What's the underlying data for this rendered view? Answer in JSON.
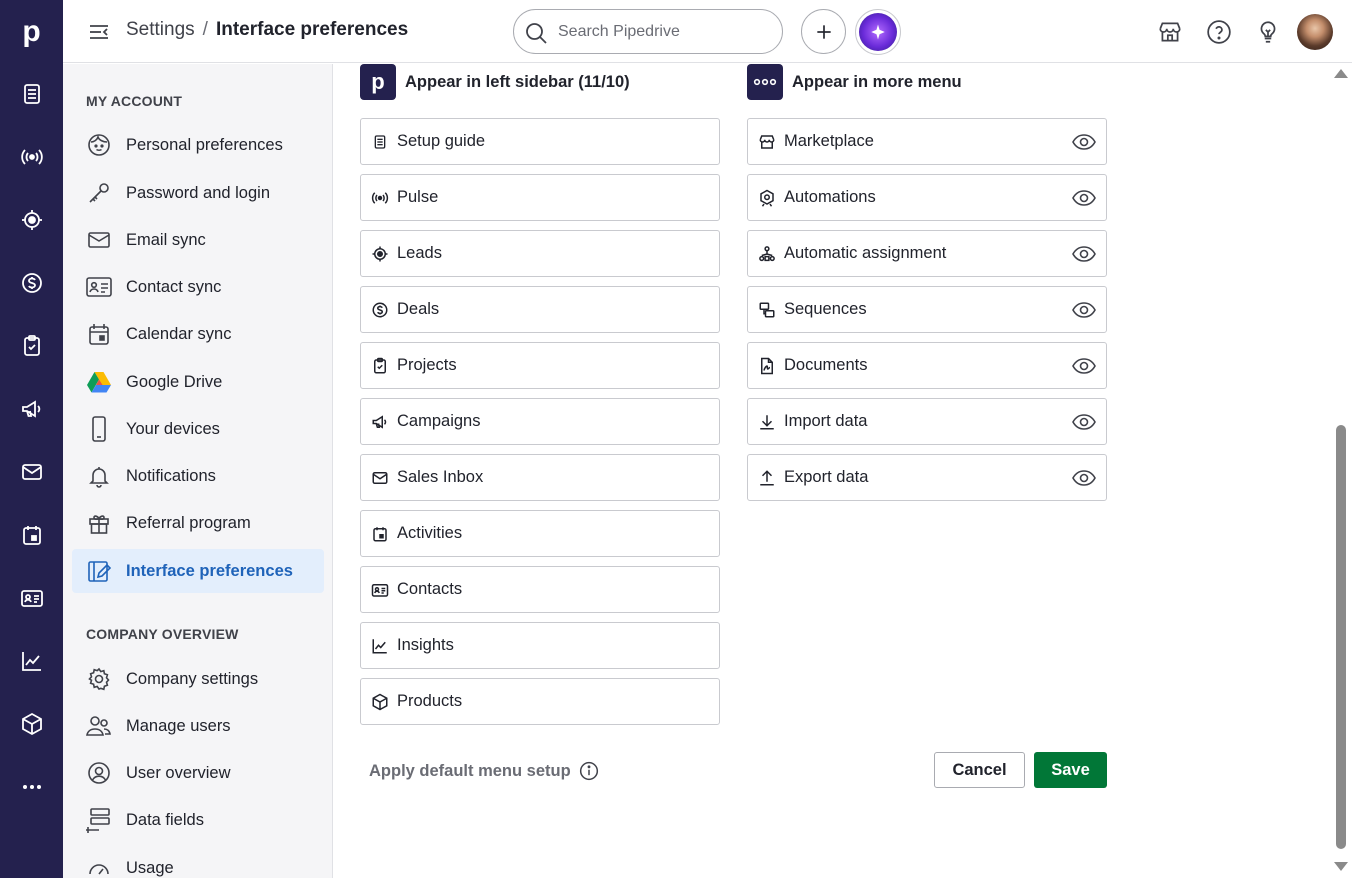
{
  "app": {
    "logo_letter": "p"
  },
  "rail": {
    "items": [
      {
        "icon": "setup-guide-icon"
      },
      {
        "icon": "pulse-icon"
      },
      {
        "icon": "leads-icon"
      },
      {
        "icon": "deals-icon"
      },
      {
        "icon": "projects-icon"
      },
      {
        "icon": "campaigns-icon"
      },
      {
        "icon": "mail-icon"
      },
      {
        "icon": "activities-icon"
      },
      {
        "icon": "contacts-icon"
      },
      {
        "icon": "insights-icon"
      },
      {
        "icon": "products-icon"
      },
      {
        "icon": "more-icon"
      }
    ]
  },
  "topbar": {
    "breadcrumb": {
      "parent": "Settings",
      "separator": "/",
      "current": "Interface preferences"
    },
    "search": {
      "placeholder": "Search Pipedrive",
      "value": ""
    }
  },
  "sidebar": {
    "my_account_title": "MY ACCOUNT",
    "my_account_items": [
      {
        "label": "Personal preferences"
      },
      {
        "label": "Password and login"
      },
      {
        "label": "Email sync"
      },
      {
        "label": "Contact sync"
      },
      {
        "label": "Calendar sync"
      },
      {
        "label": "Google Drive"
      },
      {
        "label": "Your devices"
      },
      {
        "label": "Notifications"
      },
      {
        "label": "Referral program"
      },
      {
        "label": "Interface preferences",
        "active": true
      }
    ],
    "company_title": "COMPANY OVERVIEW",
    "company_items": [
      {
        "label": "Company settings"
      },
      {
        "label": "Manage users"
      },
      {
        "label": "User overview"
      },
      {
        "label": "Data fields"
      },
      {
        "label": "Usage"
      }
    ]
  },
  "main": {
    "left_column": {
      "badge": "p",
      "title": "Appear in left sidebar (11/10)",
      "items": [
        {
          "label": "Setup guide"
        },
        {
          "label": "Pulse"
        },
        {
          "label": "Leads"
        },
        {
          "label": "Deals"
        },
        {
          "label": "Projects"
        },
        {
          "label": "Campaigns"
        },
        {
          "label": "Sales Inbox"
        },
        {
          "label": "Activities"
        },
        {
          "label": "Contacts"
        },
        {
          "label": "Insights"
        },
        {
          "label": "Products"
        }
      ]
    },
    "right_column": {
      "title": "Appear in more menu",
      "items": [
        {
          "label": "Marketplace"
        },
        {
          "label": "Automations"
        },
        {
          "label": "Automatic assignment"
        },
        {
          "label": "Sequences"
        },
        {
          "label": "Documents"
        },
        {
          "label": "Import data"
        },
        {
          "label": "Export data"
        }
      ]
    },
    "footer": {
      "default_link": "Apply default menu setup",
      "cancel_label": "Cancel",
      "save_label": "Save"
    }
  },
  "colors": {
    "rail_bg": "#24214e",
    "active_bg": "#e3eefc",
    "active_text": "#1f63b9",
    "save_bg": "#017737"
  }
}
